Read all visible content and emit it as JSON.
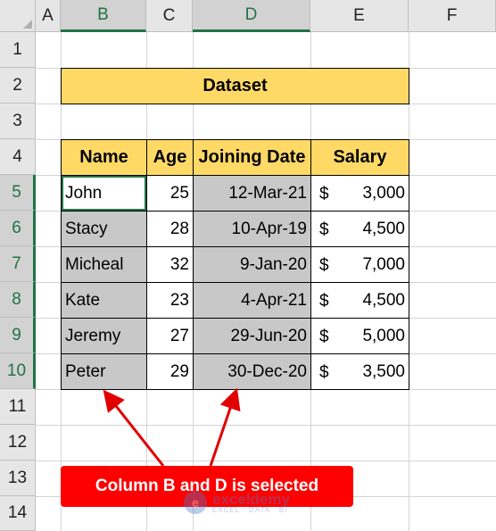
{
  "columns": [
    "A",
    "B",
    "C",
    "D",
    "E",
    "F"
  ],
  "rows": [
    "1",
    "2",
    "3",
    "4",
    "5",
    "6",
    "7",
    "8",
    "9",
    "10",
    "11",
    "12",
    "13",
    "14"
  ],
  "title": "Dataset",
  "headers": {
    "name": "Name",
    "age": "Age",
    "joining_date": "Joining Date",
    "salary": "Salary"
  },
  "currency_symbol": "$",
  "records": [
    {
      "name": "John",
      "age": "25",
      "joining_date": "12-Mar-21",
      "salary": "3,000"
    },
    {
      "name": "Stacy",
      "age": "28",
      "joining_date": "10-Apr-19",
      "salary": "4,500"
    },
    {
      "name": "Micheal",
      "age": "32",
      "joining_date": "9-Jan-20",
      "salary": "7,000"
    },
    {
      "name": "Kate",
      "age": "23",
      "joining_date": "4-Apr-21",
      "salary": "4,500"
    },
    {
      "name": "Jeremy",
      "age": "27",
      "joining_date": "29-Jun-20",
      "salary": "5,000"
    },
    {
      "name": "Peter",
      "age": "29",
      "joining_date": "30-Dec-20",
      "salary": "3,500"
    }
  ],
  "annotation": "Column B and D is selected",
  "watermark": {
    "name": "exceldemy",
    "tagline": "EXCEL · DATA · BI"
  },
  "colors": {
    "header_fill": "#ffd966",
    "selection_fill": "#c8c8c8",
    "excel_green": "#217346",
    "callout_red": "#ff0000"
  }
}
